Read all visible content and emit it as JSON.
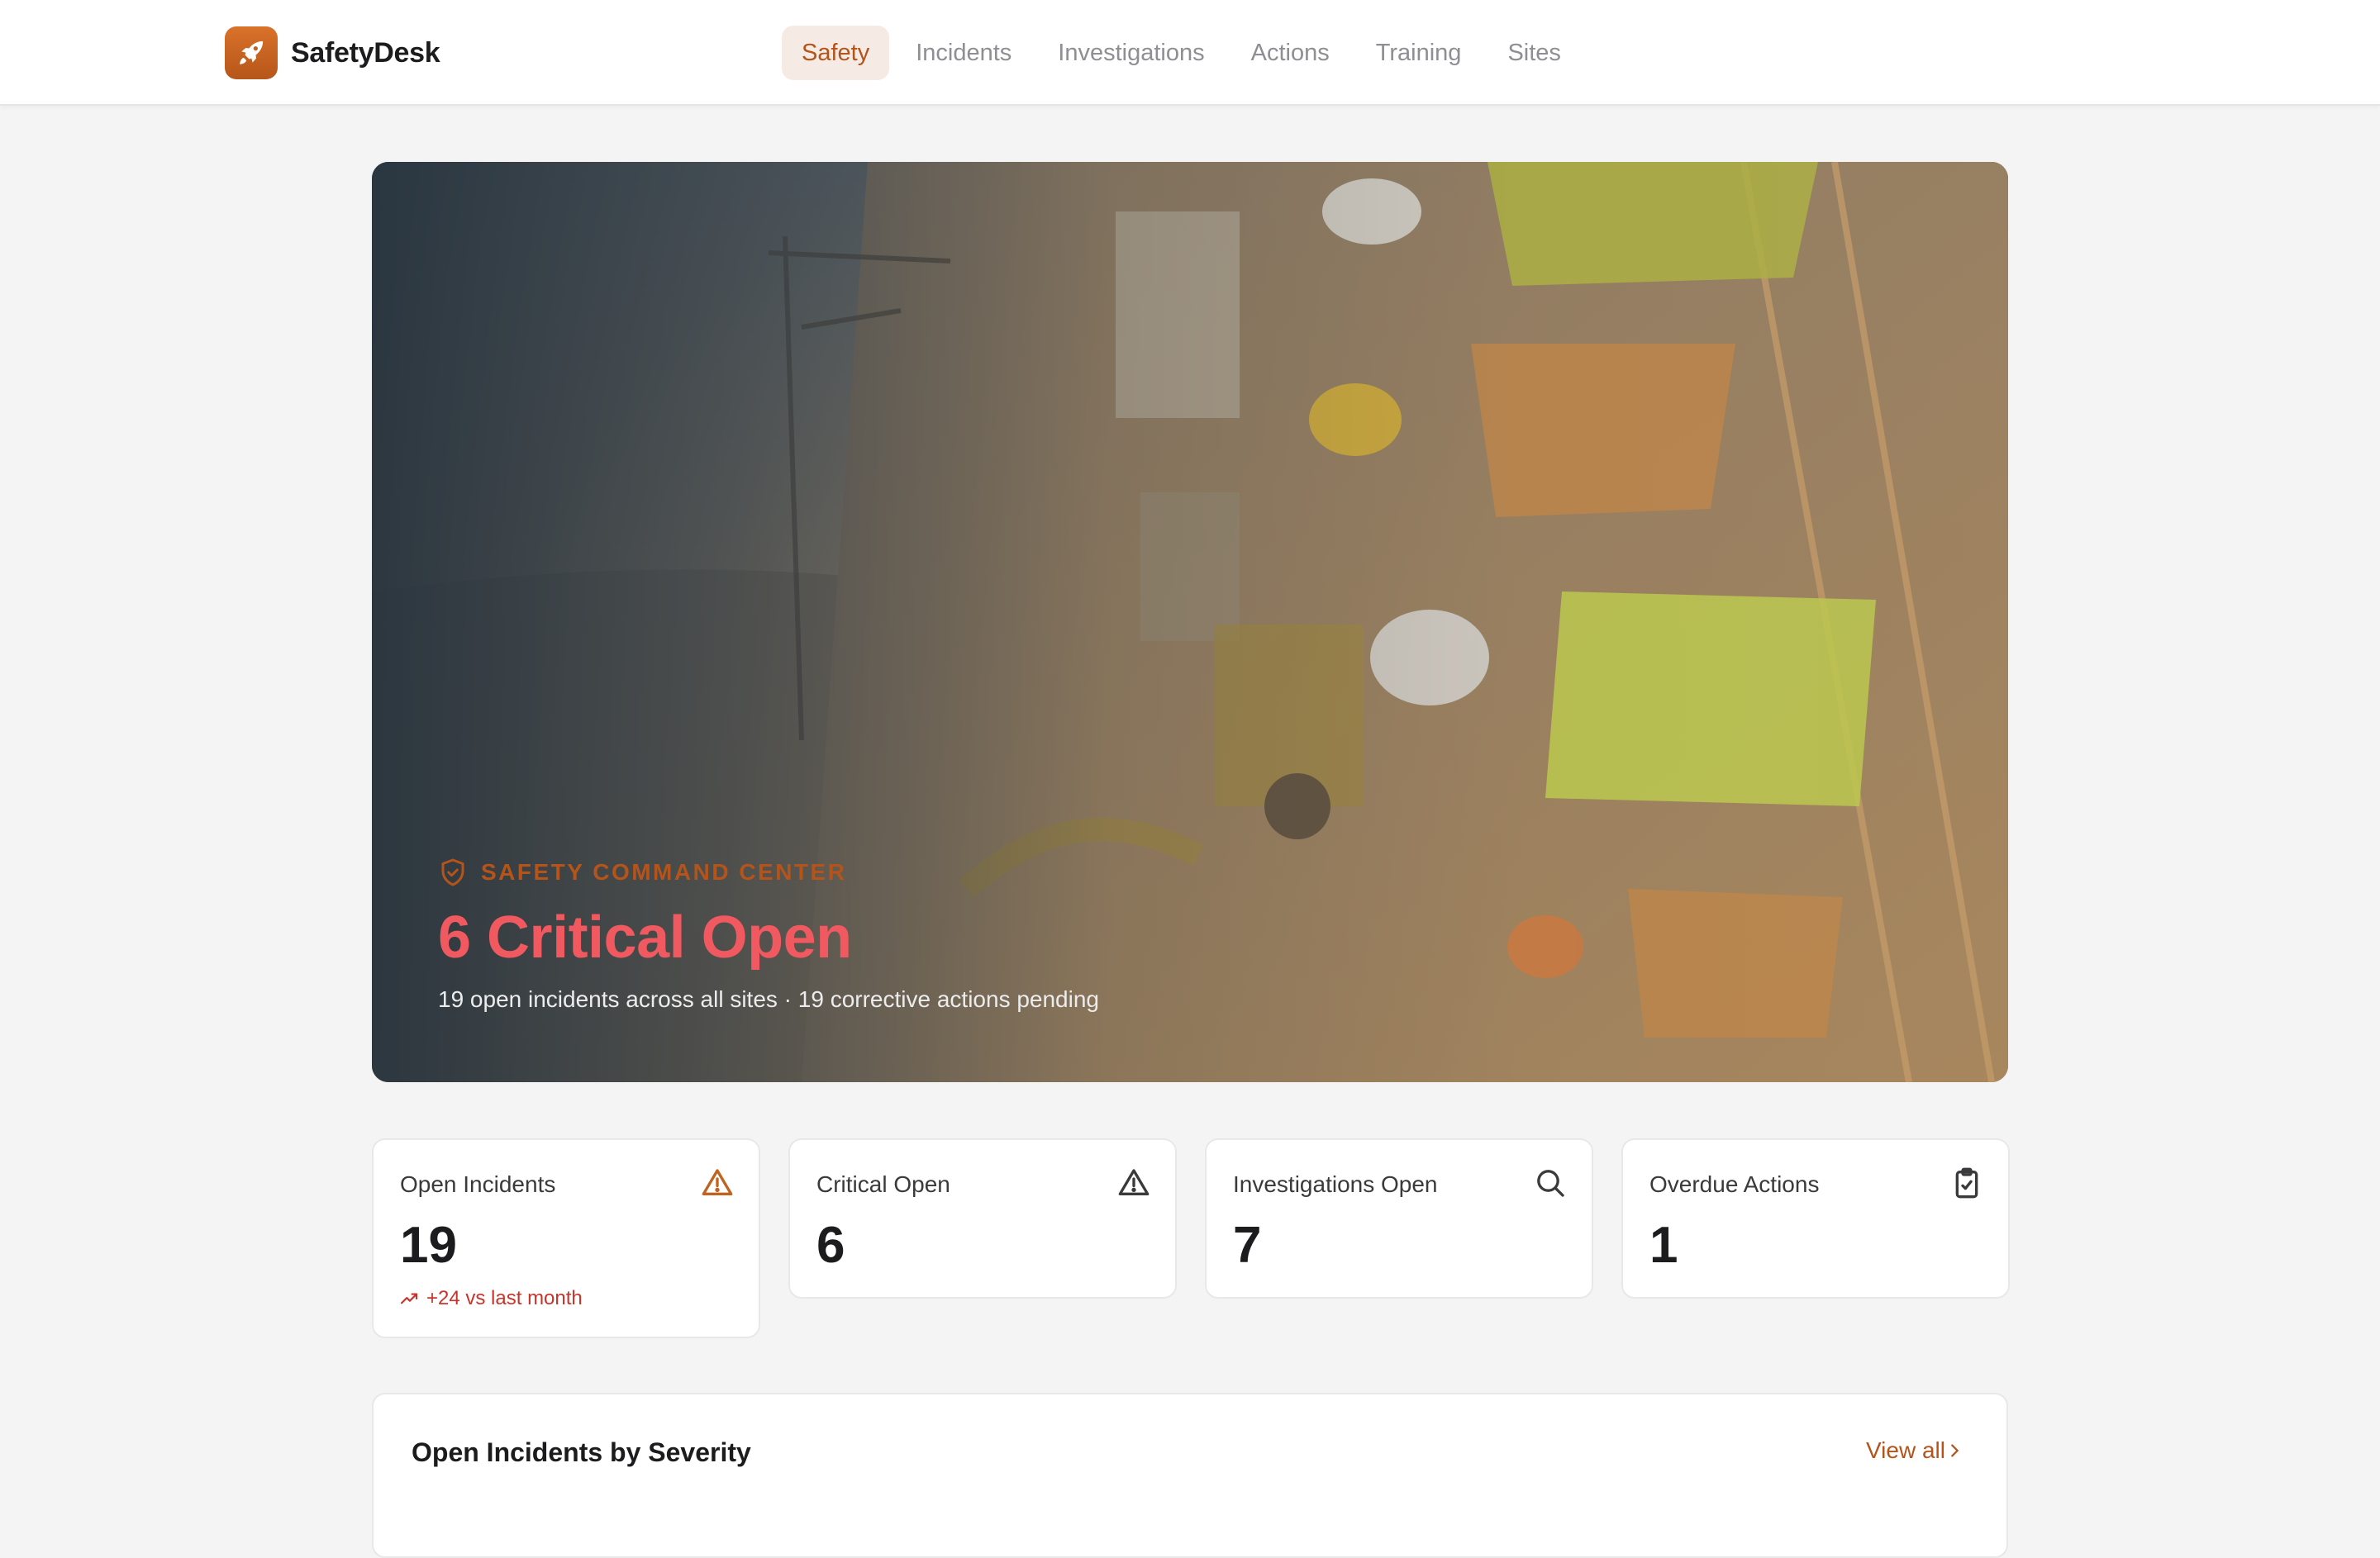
{
  "app": {
    "name": "SafetyDesk",
    "brand_color": "#c2621f",
    "logo_icon": "rocket-icon"
  },
  "nav": {
    "items": [
      {
        "label": "Safety",
        "active": true
      },
      {
        "label": "Incidents",
        "active": false
      },
      {
        "label": "Investigations",
        "active": false
      },
      {
        "label": "Actions",
        "active": false
      },
      {
        "label": "Training",
        "active": false
      },
      {
        "label": "Sites",
        "active": false
      }
    ]
  },
  "hero": {
    "kicker": "SAFETY COMMAND CENTER",
    "kicker_icon": "shield-icon",
    "title": "6 Critical Open",
    "subtitle": "19 open incidents across all sites · 19 corrective actions pending",
    "image_subject": "construction workers in hard hats and hi-vis vests on a site"
  },
  "stats": [
    {
      "label": "Open Incidents",
      "value": "19",
      "icon": "alert-triangle-icon",
      "icon_color": "#c2621f",
      "trend": "+24 vs last month"
    },
    {
      "label": "Critical Open",
      "value": "6",
      "icon": "alert-triangle-icon",
      "icon_color": "#3a3a3c"
    },
    {
      "label": "Investigations Open",
      "value": "7",
      "icon": "search-icon",
      "icon_color": "#3a3a3c"
    },
    {
      "label": "Overdue Actions",
      "value": "1",
      "icon": "clipboard-check-icon",
      "icon_color": "#3a3a3c"
    }
  ],
  "section": {
    "title": "Open Incidents by Severity",
    "link": "View all"
  },
  "colors": {
    "accent": "#b4541a",
    "critical": "#f0595f",
    "trend_up": "#c8342a"
  }
}
